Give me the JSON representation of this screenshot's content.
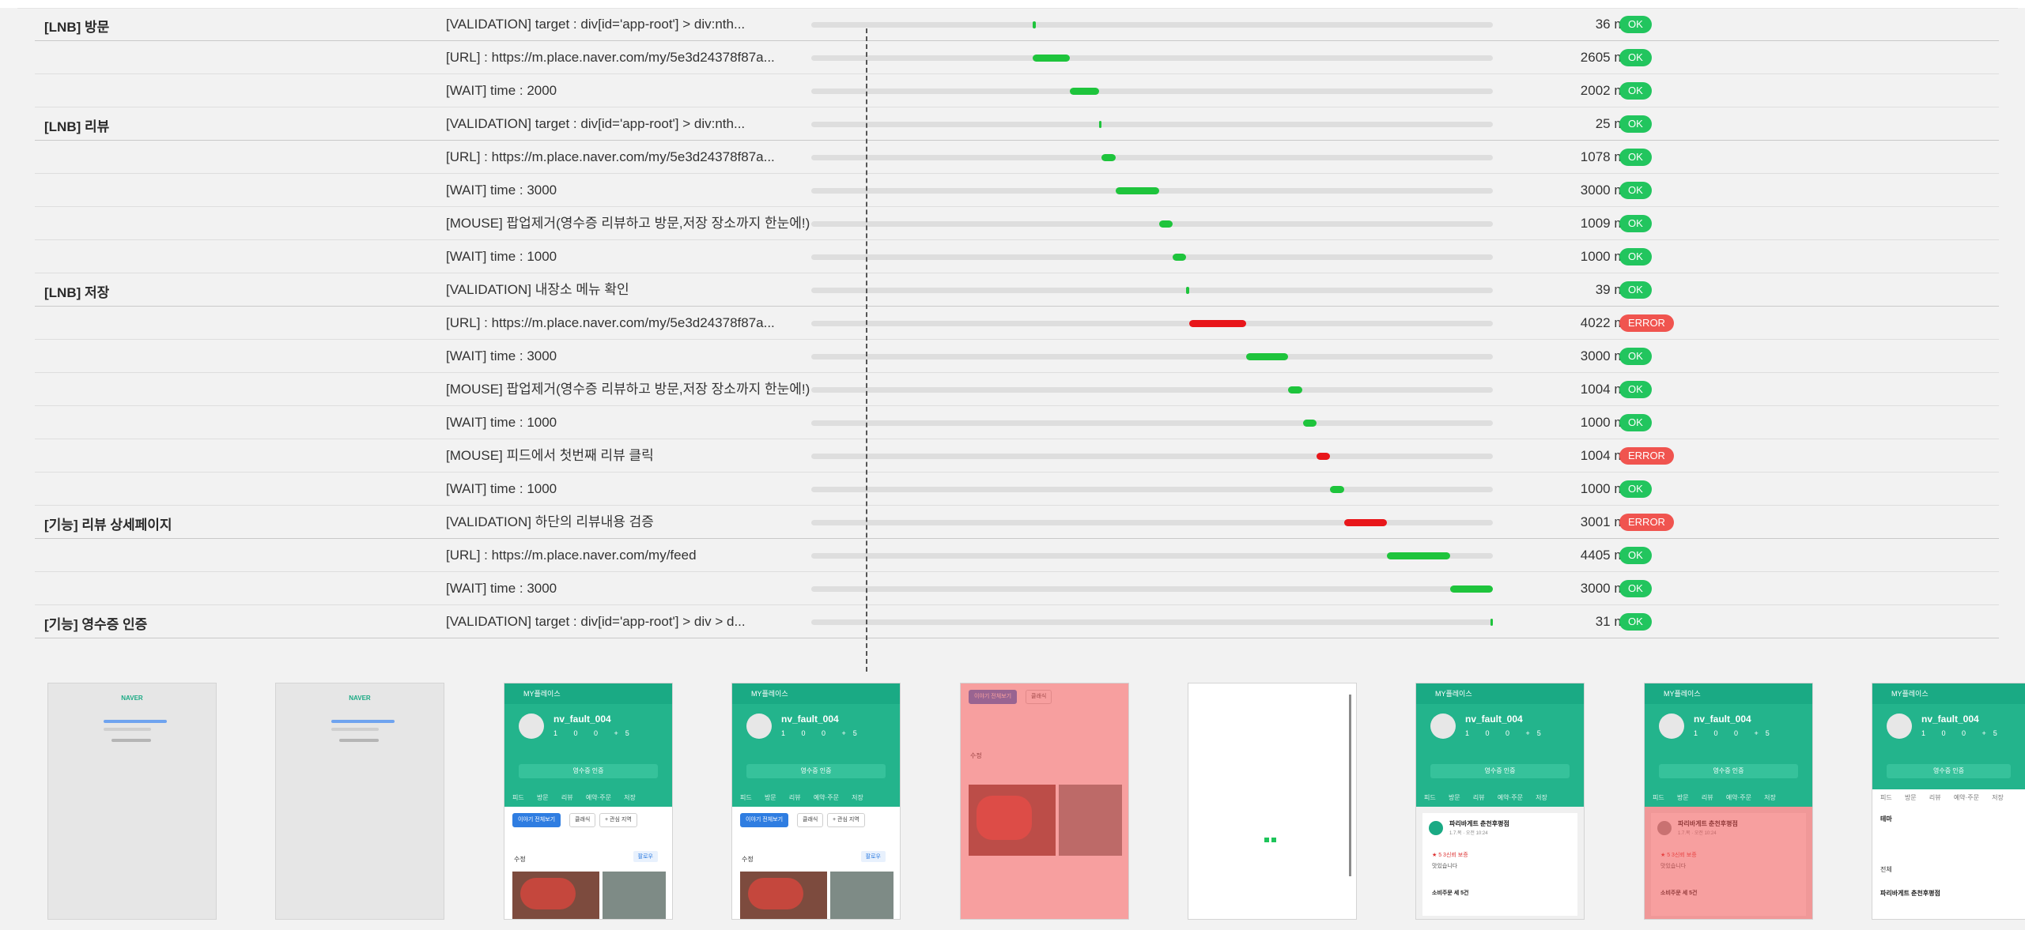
{
  "groups": [
    {
      "label": "[LNB] 방문",
      "rows": [
        0
      ]
    },
    {
      "label": "[LNB] 리뷰",
      "rows": [
        1,
        2,
        3
      ]
    },
    {
      "label": "[LNB] 저장",
      "rows": [
        4,
        5,
        6,
        7,
        8
      ]
    },
    {
      "label": "[기능] 리뷰 상세페이지",
      "rows": [
        9,
        10,
        11,
        12,
        13,
        14,
        15
      ]
    },
    {
      "label": "[기능] 영수증 인증",
      "rows": [
        16,
        17,
        18
      ]
    }
  ],
  "steps": [
    {
      "action": "[VALIDATION] target : div[id='app-root'] > div:nth...",
      "duration": "36 ms",
      "status": "OK",
      "start": 0.325,
      "end": 0.329
    },
    {
      "action": "[URL] : https://m.place.naver.com/my/5e3d24378f87a...",
      "duration": "2605 ms",
      "status": "OK",
      "start": 0.325,
      "end": 0.379
    },
    {
      "action": "[WAIT] time : 2000",
      "duration": "2002 ms",
      "status": "OK",
      "start": 0.379,
      "end": 0.422
    },
    {
      "action": "[VALIDATION] target : div[id='app-root'] > div:nth...",
      "duration": "25 ms",
      "status": "OK",
      "start": 0.422,
      "end": 0.426
    },
    {
      "action": "[URL] : https://m.place.naver.com/my/5e3d24378f87a...",
      "duration": "1078 ms",
      "status": "OK",
      "start": 0.426,
      "end": 0.447
    },
    {
      "action": "[WAIT] time : 3000",
      "duration": "3000 ms",
      "status": "OK",
      "start": 0.447,
      "end": 0.511
    },
    {
      "action": "[MOUSE] 팝업제거(영수증 리뷰하고 방문,저장 장소까지 한눈에!)",
      "duration": "1009 ms",
      "status": "OK",
      "start": 0.511,
      "end": 0.53
    },
    {
      "action": "[WAIT] time : 1000",
      "duration": "1000 ms",
      "status": "OK",
      "start": 0.53,
      "end": 0.55
    },
    {
      "action": "[VALIDATION] 내장소 메뉴 확인",
      "duration": "39 ms",
      "status": "OK",
      "start": 0.55,
      "end": 0.554
    },
    {
      "action": "[URL] : https://m.place.naver.com/my/5e3d24378f87a...",
      "duration": "4022 ms",
      "status": "ERROR",
      "start": 0.554,
      "end": 0.638
    },
    {
      "action": "[WAIT] time : 3000",
      "duration": "3000 ms",
      "status": "OK",
      "start": 0.638,
      "end": 0.7
    },
    {
      "action": "[MOUSE] 팝업제거(영수증 리뷰하고 방문,저장 장소까지 한눈에!)",
      "duration": "1004 ms",
      "status": "OK",
      "start": 0.7,
      "end": 0.721
    },
    {
      "action": "[WAIT] time : 1000",
      "duration": "1000 ms",
      "status": "OK",
      "start": 0.721,
      "end": 0.741
    },
    {
      "action": "[MOUSE] 피드에서 첫번째 리뷰 클릭",
      "duration": "1004 ms",
      "status": "ERROR",
      "start": 0.741,
      "end": 0.761
    },
    {
      "action": "[WAIT] time : 1000",
      "duration": "1000 ms",
      "status": "OK",
      "start": 0.761,
      "end": 0.782
    },
    {
      "action": "[VALIDATION] 하단의 리뷰내용 검증",
      "duration": "3001 ms",
      "status": "ERROR",
      "start": 0.782,
      "end": 0.845
    },
    {
      "action": "[URL] : https://m.place.naver.com/my/feed",
      "duration": "4405 ms",
      "status": "OK",
      "start": 0.845,
      "end": 0.937
    },
    {
      "action": "[WAIT] time : 3000",
      "duration": "3000 ms",
      "status": "OK",
      "start": 0.937,
      "end": 1.0
    },
    {
      "action": "[VALIDATION] target : div[id='app-root'] > div > d...",
      "duration": "31 ms",
      "status": "OK",
      "start": 0.996,
      "end": 1.0
    }
  ],
  "colors": {
    "ok": "#22c55e",
    "error": "#f0544f",
    "bar_ok": "#1ec43c",
    "bar_error": "#e8161a"
  },
  "thumbnails": {
    "naver_logo": "NAVER",
    "app_title": "MY플레이스",
    "username": "nv_fault_004",
    "stats": "1 0 0 +5",
    "receipt_button": "영수증 인증",
    "tabs": "피드 방문 리뷰 예약·주문 저장",
    "chip_all": "이야기 전체보기",
    "chip_photo": "클래식",
    "chip_more": "+ 관심 지역",
    "reviewer": "수정",
    "follow": "팔로우",
    "place_name": "파리바게트 춘천후평점",
    "place_date": "1.7.목 · 오전 10:24",
    "review_stars": "★ 5  3신뢰 보증",
    "review_text": "맛있습니다",
    "category": "소비주문 세 5건",
    "theme_label": "테마",
    "all_label": "전체",
    "place_name_2": "파리바게트 춘천후평점"
  }
}
